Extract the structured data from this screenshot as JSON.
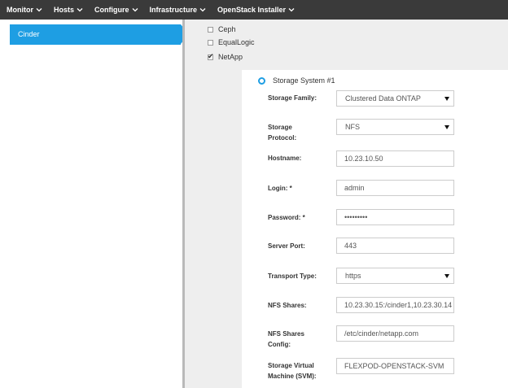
{
  "nav": {
    "items": [
      {
        "label": "Monitor",
        "name": "nav-monitor"
      },
      {
        "label": "Hosts",
        "name": "nav-hosts"
      },
      {
        "label": "Configure",
        "name": "nav-configure"
      },
      {
        "label": "Infrastructure",
        "name": "nav-infrastructure"
      },
      {
        "label": "OpenStack Installer",
        "name": "nav-openstack-installer"
      }
    ],
    "chevron_icon": "chevron-down-icon"
  },
  "sidebar": {
    "items": [
      {
        "label": "Cinder",
        "active": true
      }
    ]
  },
  "backends": [
    {
      "label": "Ceph",
      "checked": false
    },
    {
      "label": "EqualLogic",
      "checked": false
    },
    {
      "label": "NetApp",
      "checked": true
    }
  ],
  "storage_system": {
    "title": "Storage System #1",
    "fields": {
      "storage_family": {
        "label": "Storage Family:",
        "value": "Clustered Data ONTAP"
      },
      "storage_protocol": {
        "label_line1": "Storage",
        "label_line2": "Protocol:",
        "value": "NFS"
      },
      "hostname": {
        "label": "Hostname:",
        "value": "10.23.10.50"
      },
      "login": {
        "label": "Login: *",
        "value": "admin"
      },
      "password": {
        "label": "Password: *",
        "value": "•••••••••"
      },
      "server_port": {
        "label": "Server Port:",
        "value": "443"
      },
      "transport_type": {
        "label": "Transport Type:",
        "value": "https"
      },
      "nfs_shares": {
        "label": "NFS Shares:",
        "value": "10.23.30.15:/cinder1,10.23.30.14"
      },
      "nfs_shares_config": {
        "label_line1": "NFS Shares",
        "label_line2": "Config:",
        "value": "/etc/cinder/netapp.com"
      },
      "svm": {
        "label_line1": "Storage Virtual",
        "label_line2": "Machine (SVM):",
        "value": "FLEXPOD-OPENSTACK-SVM"
      }
    }
  },
  "colors": {
    "nav_bg": "#3a3a3a",
    "accent": "#1e9ee3",
    "main_bg": "#eeeeee"
  }
}
